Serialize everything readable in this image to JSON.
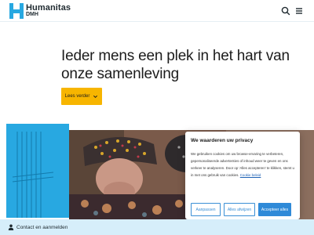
{
  "header": {
    "brand_name": "Humanitas",
    "brand_sub": "DMH",
    "brand_color": "#28a8e1",
    "search_icon": "search-icon",
    "menu_icon": "hamburger-menu-icon"
  },
  "hero": {
    "headline": "Ieder mens een plek in het hart van onze samenleving",
    "read_more_label": "Lees verder",
    "read_more_icon": "chevron-down-icon",
    "button_color": "#f7b500",
    "accent_block_color": "#28a8e1"
  },
  "cookie_banner": {
    "title": "We waarderen uw privacy",
    "text": "We gebruiken cookies om uw browse-ervaring te verbeteren, gepersonaliseerde advertenties of inhoud weer te geven en ons verkeer te analyseren. Door op 'Alles accepteren' te klikken, stemt u in met ons gebruik van cookies.",
    "policy_link": "Cookie beleid",
    "customize_label": "Aanpassen",
    "decline_label": "Alles afwijzen",
    "accept_label": "Accepteer alles",
    "accent_color": "#2f8ad8"
  },
  "footer_bar": {
    "contact_label": "Contact en aanmelden",
    "contact_icon": "person-icon",
    "bar_color": "#d6eefa"
  }
}
